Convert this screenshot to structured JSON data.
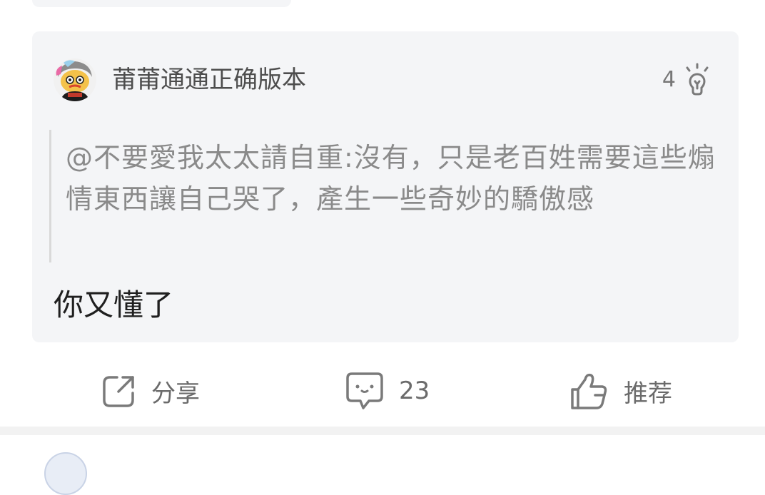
{
  "comment": {
    "author": "莆莆通通正确版本",
    "like_count": "4",
    "quote": "@不要愛我太太請自重:沒有，只是老百姓需要這些煽情東西讓自己哭了，產生一些奇妙的驕傲感",
    "reply": "你又懂了"
  },
  "actions": {
    "share_label": "分享",
    "comment_count": "23",
    "recommend_label": "推荐"
  },
  "icons": {
    "avatar": "avatar-cartoon",
    "like": "lightbulb-icon",
    "share": "share-icon",
    "comment": "comment-icon",
    "recommend": "thumbs-up-icon"
  },
  "colors": {
    "card_bg": "#f4f5f7",
    "muted_text": "#8a8a8a",
    "icon_gray": "#7a7a7a"
  }
}
